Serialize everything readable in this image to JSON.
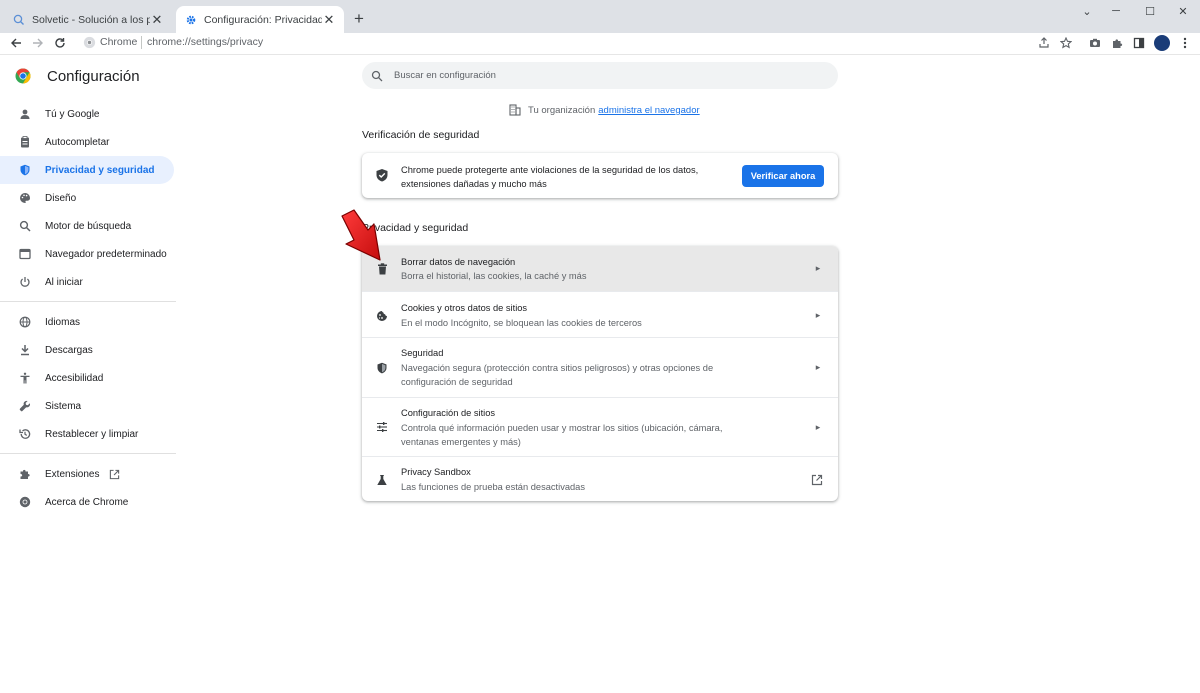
{
  "browser": {
    "tabs": [
      {
        "title": "Solvetic - Solución a los problem",
        "active": false
      },
      {
        "title": "Configuración: Privacidad y segu",
        "active": true
      }
    ],
    "new_tab_label": "+",
    "chip_label": "Chrome",
    "url": "chrome://settings/privacy",
    "url_scheme": "chrome://",
    "url_path": "settings/privacy"
  },
  "settings": {
    "title": "Configuración",
    "search_placeholder": "Buscar en configuración",
    "sidebar": [
      {
        "label": "Tú y Google",
        "icon": "person-icon"
      },
      {
        "label": "Autocompletar",
        "icon": "clipboard-icon"
      },
      {
        "label": "Privacidad y seguridad",
        "icon": "shield-icon",
        "selected": true
      },
      {
        "label": "Diseño",
        "icon": "palette-icon"
      },
      {
        "label": "Motor de búsqueda",
        "icon": "search-icon"
      },
      {
        "label": "Navegador predeterminado",
        "icon": "browser-icon"
      },
      {
        "label": "Al iniciar",
        "icon": "power-icon"
      },
      {
        "label": "Idiomas",
        "icon": "globe-icon"
      },
      {
        "label": "Descargas",
        "icon": "download-icon"
      },
      {
        "label": "Accesibilidad",
        "icon": "accessibility-icon"
      },
      {
        "label": "Sistema",
        "icon": "wrench-icon"
      },
      {
        "label": "Restablecer y limpiar",
        "icon": "history-icon"
      },
      {
        "label": "Extensiones",
        "icon": "puzzle-icon"
      },
      {
        "label": "Acerca de Chrome",
        "icon": "chrome-icon"
      }
    ],
    "org_notice_prefix": "Tu organización",
    "org_notice_link": "administra el navegador",
    "safety_section_title": "Verificación de seguridad",
    "safety_text": "Chrome puede protegerte ante violaciones de la seguridad de los datos, extensiones dañadas y mucho más",
    "safety_button": "Verificar ahora",
    "privacy_section_title": "Privacidad y seguridad",
    "privacy_rows": [
      {
        "title": "Borrar datos de navegación",
        "subtitle": "Borra el historial, las cookies, la caché y más",
        "icon": "trash-icon",
        "action": "arrow"
      },
      {
        "title": "Cookies y otros datos de sitios",
        "subtitle": "En el modo Incógnito, se bloquean las cookies de terceros",
        "icon": "cookie-icon",
        "action": "arrow"
      },
      {
        "title": "Seguridad",
        "subtitle": "Navegación segura (protección contra sitios peligrosos) y otras opciones de configuración de seguridad",
        "icon": "shield-icon",
        "action": "arrow"
      },
      {
        "title": "Configuración de sitios",
        "subtitle": "Controla qué información pueden usar y mostrar los sitios (ubicación, cámara, ventanas emergentes y más)",
        "icon": "sliders-icon",
        "action": "arrow"
      },
      {
        "title": "Privacy Sandbox",
        "subtitle": "Las funciones de prueba están desactivadas",
        "icon": "flask-icon",
        "action": "external"
      }
    ]
  },
  "colors": {
    "accent": "#1a73e8",
    "selected_bg": "#e8f0fe",
    "annotation_arrow": "#e81c1c"
  }
}
